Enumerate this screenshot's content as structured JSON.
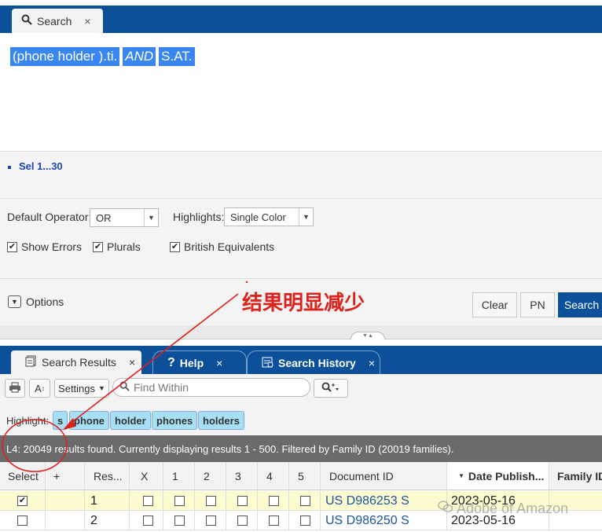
{
  "top_tab": {
    "label": "Search",
    "close": "×"
  },
  "query": {
    "term1": "(phone holder ).ti.",
    "operator": "AND",
    "term2": "S.AT."
  },
  "selection": {
    "label": "Sel 1...30"
  },
  "options": {
    "default_operator_label": "Default Operator:",
    "default_operator_value": "OR",
    "highlights_label": "Highlights:",
    "highlights_value": "Single Color",
    "show_errors": "Show Errors",
    "plurals": "Plurals",
    "british": "British Equivalents",
    "options_toggle": "Options"
  },
  "buttons": {
    "clear": "Clear",
    "pn": "PN",
    "search": "Search"
  },
  "annotation": "结果明显减少",
  "result_tabs": [
    {
      "label": "Search Results",
      "close": "×"
    },
    {
      "label": "Help",
      "close": "×"
    },
    {
      "label": "Search History",
      "close": "×"
    }
  ],
  "toolbar": {
    "settings": "Settings",
    "find_placeholder": "Find Within",
    "font_label": "A"
  },
  "highlight": {
    "label": "Highlight:",
    "terms": [
      "s",
      "phone",
      "holder",
      "phones",
      "holders"
    ]
  },
  "status": "L4:  20049 results found. Currently displaying results 1 - 500. Filtered by Family ID (20019 families).",
  "grid": {
    "headers": [
      "Select",
      "+",
      "Res...",
      "X",
      "1",
      "2",
      "3",
      "4",
      "5",
      "Document ID",
      "Date Publish...",
      "Family ID"
    ],
    "rows": [
      {
        "selected": true,
        "result": "1",
        "doc_id": "US D986253 S",
        "date": "2023-05-16"
      },
      {
        "selected": false,
        "result": "2",
        "doc_id": "US D986250 S",
        "date": "2023-05-16"
      }
    ]
  },
  "watermark": "Adobe of Amazon"
}
